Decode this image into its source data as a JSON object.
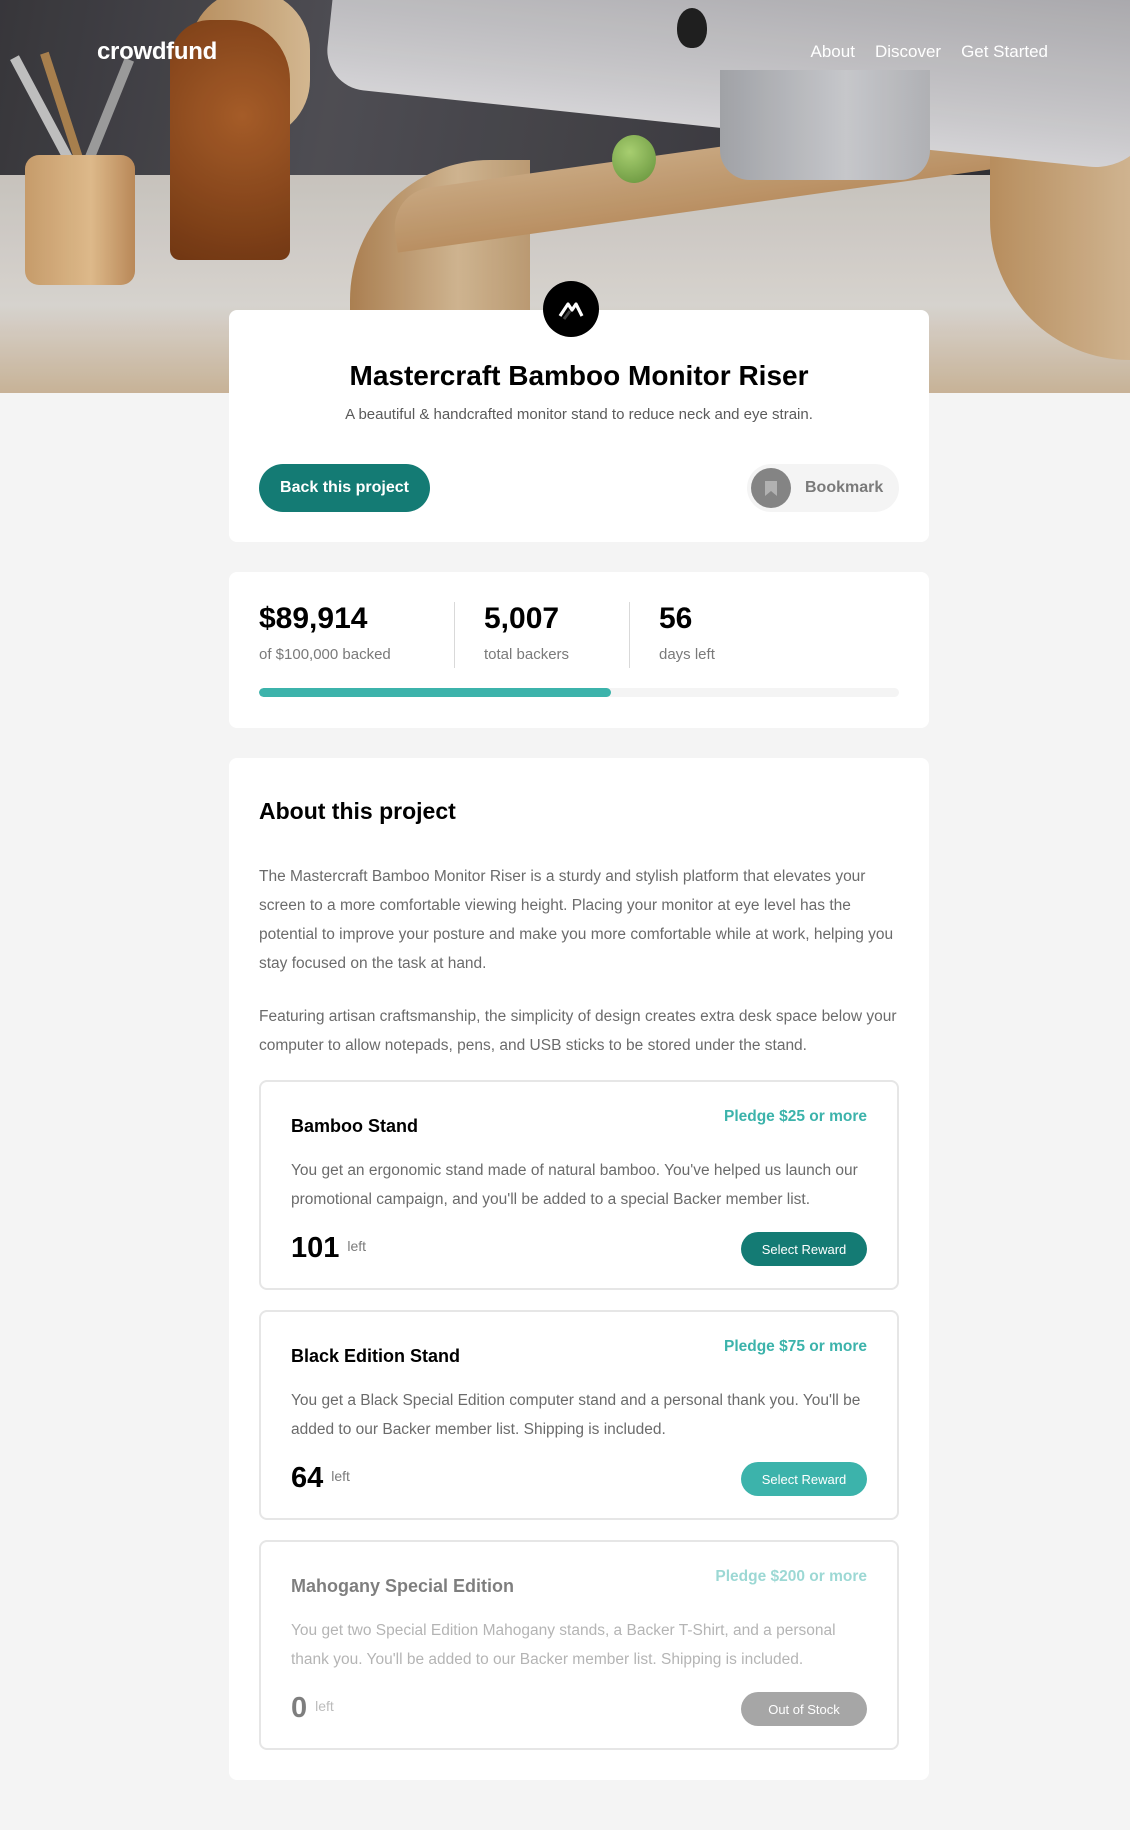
{
  "nav": {
    "logo": "crowdfund",
    "links": [
      "About",
      "Discover",
      "Get Started"
    ]
  },
  "project": {
    "title": "Mastercraft Bamboo Monitor Riser",
    "subtitle": "A beautiful & handcrafted monitor stand to reduce neck and eye strain.",
    "back_button": "Back this project",
    "bookmark_button": "Bookmark"
  },
  "stats": {
    "backed": {
      "value": "$89,914",
      "label": "of $100,000 backed"
    },
    "backers": {
      "value": "5,007",
      "label": "total backers"
    },
    "days": {
      "value": "56",
      "label": "days left"
    },
    "progress_fraction": 0.55
  },
  "about": {
    "heading": "About this project",
    "paragraph1": "The Mastercraft Bamboo Monitor Riser is a sturdy and stylish platform that elevates your screen to a more comfortable viewing height. Placing your monitor at eye level has the potential to improve your posture and make you more comfortable while at work, helping you stay focused on the task at hand.",
    "paragraph2": "Featuring artisan craftsmanship, the simplicity of design creates extra desk space below your computer to allow notepads, pens, and USB sticks to be stored under the stand."
  },
  "rewards": [
    {
      "name": "Bamboo Stand",
      "pledge": "Pledge $25 or more",
      "description": "You get an ergonomic stand made of natural bamboo. You've helped us launch our promotional campaign, and you'll be added to a special Backer member list.",
      "count": "101",
      "left_label": "left",
      "button": "Select Reward"
    },
    {
      "name": "Black Edition Stand",
      "pledge": "Pledge $75 or more",
      "description": "You get a Black Special Edition computer stand and a personal thank you. You'll be added to our Backer member list. Shipping is included.",
      "count": "64",
      "left_label": "left",
      "button": "Select Reward"
    },
    {
      "name": "Mahogany Special Edition",
      "pledge": "Pledge $200 or more",
      "description": "You get two Special Edition Mahogany stands, a Backer T-Shirt, and a personal thank you. You'll be added to our Backer member list. Shipping is included.",
      "count": "0",
      "left_label": "left",
      "button": "Out of Stock"
    }
  ],
  "colors": {
    "accent_dark": "#147b74",
    "accent": "#3cb3ab",
    "disabled": "#a6a6a6",
    "background": "#f4f4f4"
  },
  "icons": {
    "logo": "mastercraft-logo-icon",
    "bookmark": "bookmark-icon"
  }
}
